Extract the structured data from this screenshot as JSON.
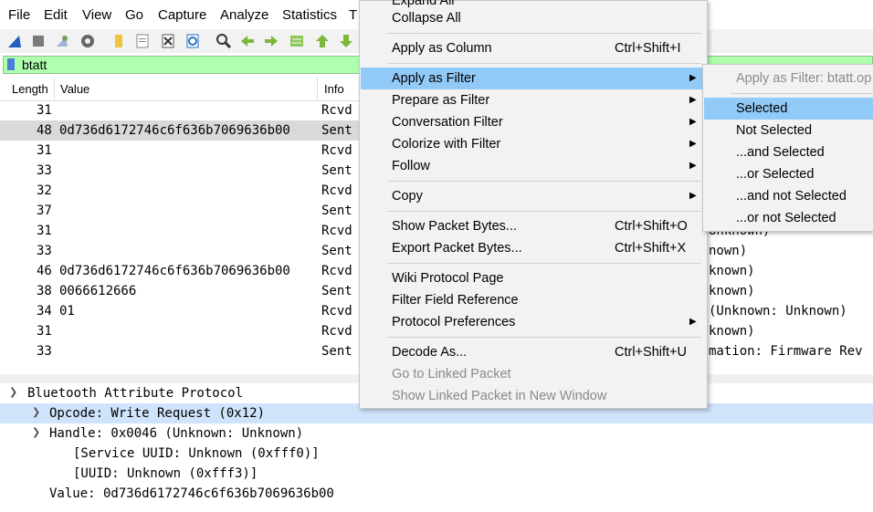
{
  "menubar": [
    "File",
    "Edit",
    "View",
    "Go",
    "Capture",
    "Analyze",
    "Statistics",
    "T"
  ],
  "toolbar_icons": [
    "shark-fin-icon",
    "stop-icon",
    "restart-icon",
    "gear-icon",
    "open-file-icon",
    "save-file-icon",
    "close-file-icon",
    "reload-icon",
    "find-icon",
    "back-arrow-icon",
    "forward-arrow-icon",
    "goto-packet-icon",
    "first-packet-icon",
    "last-packet-icon"
  ],
  "filter": {
    "value": "btatt"
  },
  "columns": {
    "length": "Length",
    "value": "Value",
    "info": "Info"
  },
  "packets": [
    {
      "length": "31",
      "value": "",
      "info": "Rcvd",
      "info_tail": ""
    },
    {
      "length": "48",
      "value": "0d736d6172746c6f636b7069636b00",
      "info": "Sent",
      "info_tail": ""
    },
    {
      "length": "31",
      "value": "",
      "info": "Rcvd",
      "info_tail": ""
    },
    {
      "length": "33",
      "value": "",
      "info": "Sent",
      "info_tail": ""
    },
    {
      "length": "32",
      "value": "",
      "info": "Rcvd",
      "info_tail": ""
    },
    {
      "length": "37",
      "value": "",
      "info": "Sent",
      "info_tail": ""
    },
    {
      "length": "31",
      "value": "",
      "info": "Rcvd",
      "info_tail": "Unknown)"
    },
    {
      "length": "33",
      "value": "",
      "info": "Sent",
      "info_tail": "nown)"
    },
    {
      "length": "46",
      "value": "0d736d6172746c6f636b7069636b00",
      "info": "Rcvd",
      "info_tail": "known)"
    },
    {
      "length": "38",
      "value": "0066612666",
      "info": "Sent",
      "info_tail": "known)"
    },
    {
      "length": "34",
      "value": "01",
      "info": "Rcvd",
      "info_tail": "(Unknown: Unknown)"
    },
    {
      "length": "31",
      "value": "",
      "info": "Rcvd",
      "info_tail": "known)"
    },
    {
      "length": "33",
      "value": "",
      "info": "Sent",
      "info_tail": "mation: Firmware Rev"
    }
  ],
  "details": {
    "protocol": "Bluetooth Attribute Protocol",
    "opcode": "Opcode: Write Request (0x12)",
    "handle": "Handle: 0x0046 (Unknown: Unknown)",
    "service_uuid": "[Service UUID: Unknown (0xfff0)]",
    "uuid": "[UUID: Unknown (0xfff3)]",
    "value": "Value: 0d736d6172746c6f636b7069636b00"
  },
  "context_menu": {
    "expand_all": "Expand All",
    "collapse_all": "Collapse All",
    "apply_as_column": "Apply as Column",
    "apply_as_column_shortcut": "Ctrl+Shift+I",
    "apply_as_filter": "Apply as Filter",
    "prepare_as_filter": "Prepare as Filter",
    "conversation_filter": "Conversation Filter",
    "colorize_with_filter": "Colorize with Filter",
    "follow": "Follow",
    "copy": "Copy",
    "show_packet_bytes": "Show Packet Bytes...",
    "show_packet_bytes_shortcut": "Ctrl+Shift+O",
    "export_packet_bytes": "Export Packet Bytes...",
    "export_packet_bytes_shortcut": "Ctrl+Shift+X",
    "wiki_protocol_page": "Wiki Protocol Page",
    "filter_field_reference": "Filter Field Reference",
    "protocol_preferences": "Protocol Preferences",
    "decode_as": "Decode As...",
    "decode_as_shortcut": "Ctrl+Shift+U",
    "go_to_linked_packet": "Go to Linked Packet",
    "show_linked_packet": "Show Linked Packet in New Window"
  },
  "submenu": {
    "header": "Apply as Filter: btatt.op",
    "selected": "Selected",
    "not_selected": "Not Selected",
    "and_selected": "...and Selected",
    "or_selected": "...or Selected",
    "and_not_selected": "...and not Selected",
    "or_not_selected": "...or not Selected"
  },
  "colors": {
    "filter_ok": "#afffaf",
    "menu_highlight": "#91c9f7",
    "detail_highlight": "#cfe3fb",
    "row_selected": "#d9d9d9"
  }
}
